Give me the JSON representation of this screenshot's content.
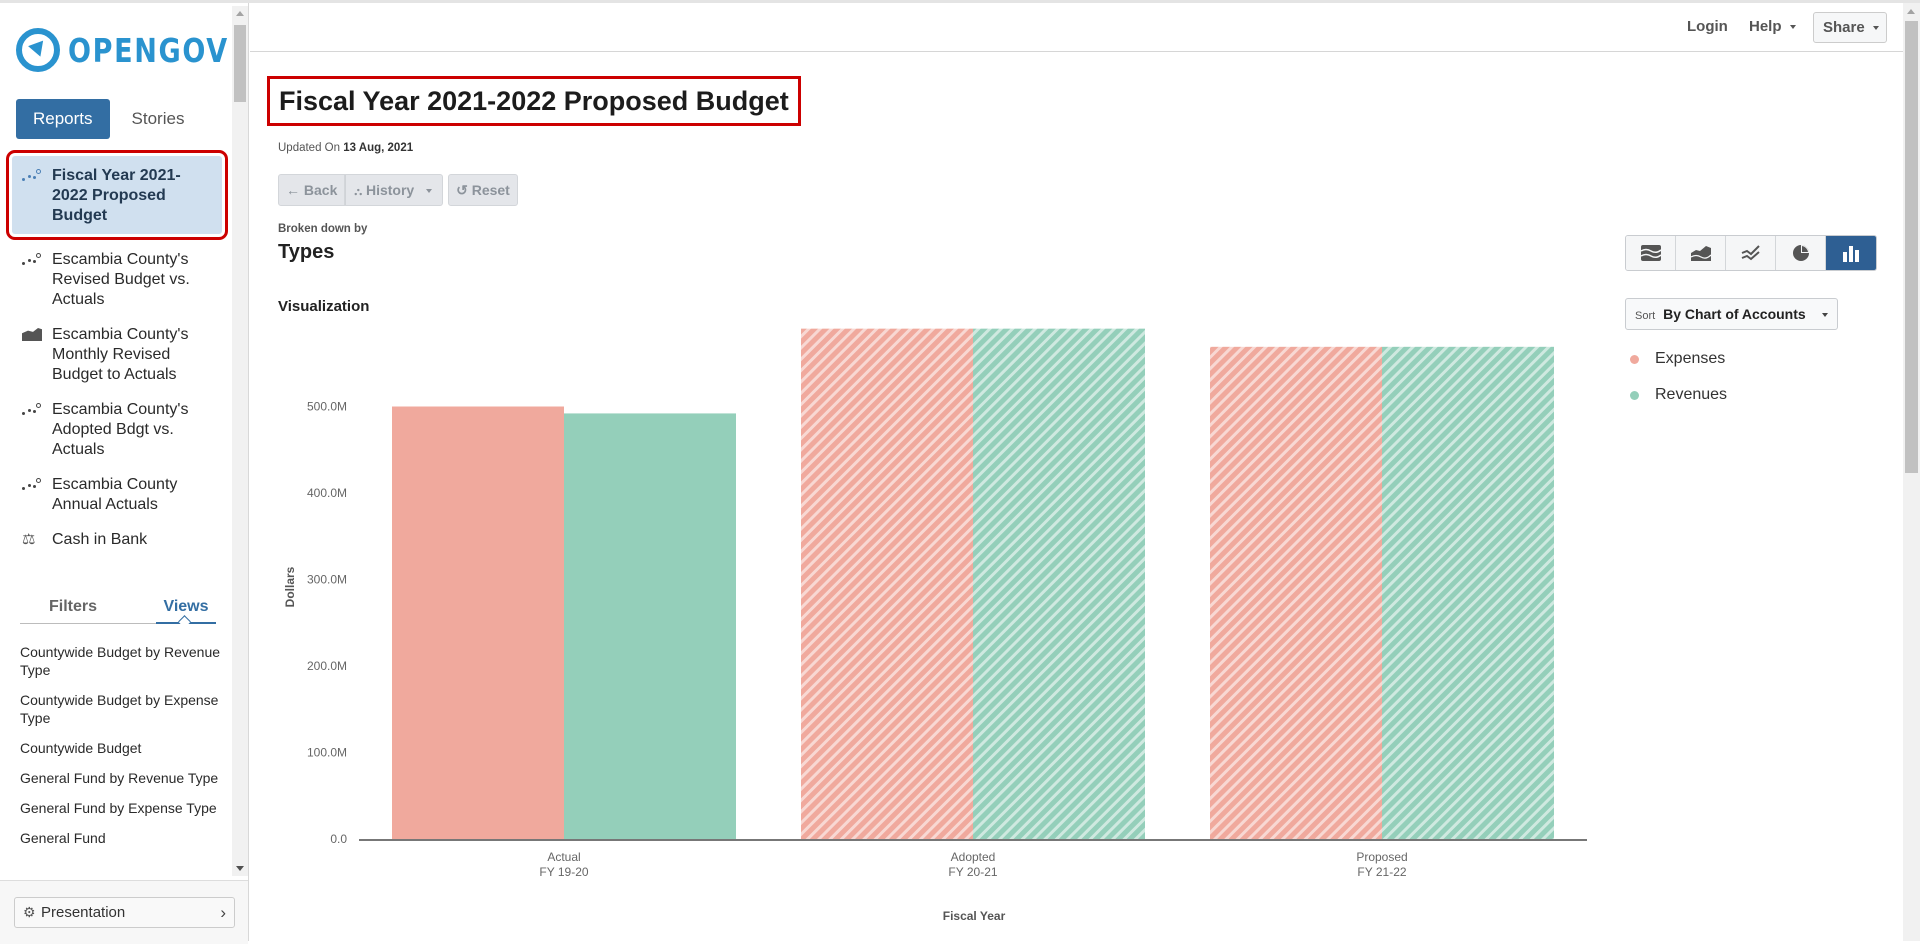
{
  "brand": {
    "name": "OPENGOV",
    "color": "#2a93cf"
  },
  "sidebar": {
    "mode_tabs": [
      {
        "label": "Reports",
        "active": true
      },
      {
        "label": "Stories",
        "active": false
      }
    ],
    "reports": [
      {
        "label": "Fiscal Year 2021-2022 Proposed Budget",
        "icon": "scatter-dots-icon",
        "selected": true
      },
      {
        "label": "Escambia County's Revised Budget vs. Actuals",
        "icon": "scatter-dots-icon",
        "selected": false
      },
      {
        "label": "Escambia County's Monthly Revised Budget to Actuals",
        "icon": "area-chart-icon",
        "selected": false
      },
      {
        "label": "Escambia County's Adopted Bdgt vs. Actuals",
        "icon": "scatter-dots-icon",
        "selected": false
      },
      {
        "label": "Escambia County Annual Actuals",
        "icon": "scatter-dots-icon",
        "selected": false
      },
      {
        "label": "Cash in Bank",
        "icon": "balance-scale-icon",
        "selected": false
      }
    ],
    "panel_tabs": [
      {
        "label": "Filters",
        "active": false
      },
      {
        "label": "Views",
        "active": true
      }
    ],
    "views": [
      "Countywide Budget by Revenue Type",
      "Countywide Budget by Expense Type",
      "Countywide Budget",
      "General Fund by Revenue Type",
      "General Fund by Expense Type",
      "General Fund"
    ],
    "presentation_label": "Presentation"
  },
  "header": {
    "login": "Login",
    "help": "Help",
    "share": "Share"
  },
  "report": {
    "title": "Fiscal Year 2021-2022 Proposed Budget",
    "updated_prefix": "Updated On",
    "updated_date": "13 Aug, 2021",
    "back_label": "Back",
    "history_label": "History",
    "reset_label": "Reset",
    "broken_down_label": "Broken down by",
    "broken_down_value": "Types",
    "visualization_label": "Visualization",
    "chart_types": [
      {
        "name": "stacked-area-icon",
        "active": false
      },
      {
        "name": "area-icon",
        "active": false
      },
      {
        "name": "line-icon",
        "active": false
      },
      {
        "name": "pie-icon",
        "active": false
      },
      {
        "name": "bar-icon",
        "active": true
      }
    ],
    "sort_prefix": "Sort",
    "sort_value": "By Chart of Accounts"
  },
  "chart_data": {
    "type": "bar",
    "title": "",
    "xlabel": "Fiscal Year",
    "ylabel": "Dollars",
    "ylim": [
      0,
      590000000
    ],
    "yticks": [
      0,
      100000000,
      200000000,
      300000000,
      400000000,
      500000000
    ],
    "ytick_labels": [
      "0.0",
      "100.0M",
      "200.0M",
      "300.0M",
      "400.0M",
      "500.0M"
    ],
    "categories": [
      {
        "line1": "Actual",
        "line2": "FY 19-20",
        "hatched": false
      },
      {
        "line1": "Adopted",
        "line2": "FY 20-21",
        "hatched": true
      },
      {
        "line1": "Proposed",
        "line2": "FY 21-22",
        "hatched": true
      }
    ],
    "series": [
      {
        "name": "Expenses",
        "color": "#f0a99d",
        "values": [
          500000000,
          590000000,
          569000000
        ]
      },
      {
        "name": "Revenues",
        "color": "#94cfba",
        "values": [
          492000000,
          590000000,
          569000000
        ]
      }
    ],
    "legend": "right",
    "grid": false
  }
}
